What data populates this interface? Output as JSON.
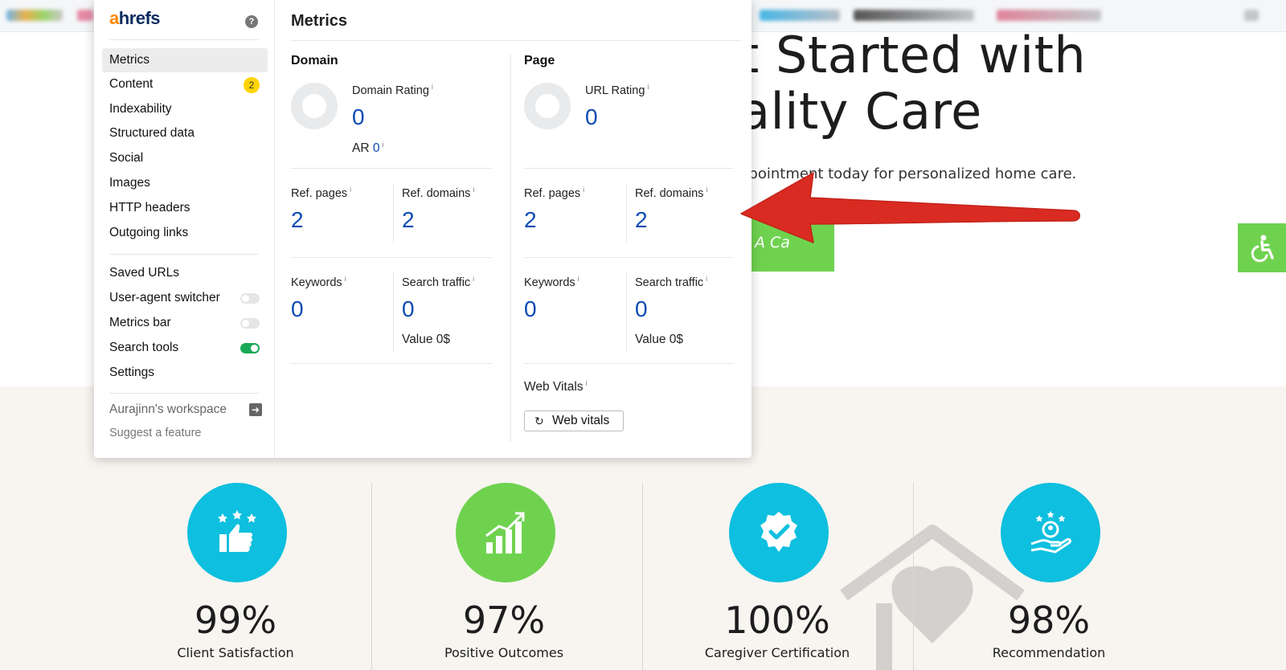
{
  "site": {
    "hero_line1": "t Started with",
    "hero_line2": "ality Care",
    "hero_subtitle": "ppointment today for personalized home care.",
    "cta_label": "le A Ca",
    "accessibility_icon": "wheelchair-icon",
    "accent_green": "#6fd24f",
    "accent_teal": "#0ebfdf",
    "stats": [
      {
        "value": "99%",
        "label": "Client Satisfaction",
        "icon": "thumbs-up-stars-icon",
        "color": "#0ebfdf"
      },
      {
        "value": "97%",
        "label": "Positive Outcomes",
        "icon": "growth-chart-icon",
        "color": "#6fd24f"
      },
      {
        "value": "100%",
        "label": "Caregiver Certification",
        "icon": "certified-badge-icon",
        "color": "#0ebfdf"
      },
      {
        "value": "98%",
        "label": "Recommendation",
        "icon": "care-hand-icon",
        "color": "#0ebfdf"
      }
    ]
  },
  "ahrefs": {
    "logo_first": "a",
    "logo_rest": "hrefs",
    "nav": [
      {
        "label": "Metrics",
        "active": true
      },
      {
        "label": "Content",
        "badge": "2"
      },
      {
        "label": "Indexability"
      },
      {
        "label": "Structured data"
      },
      {
        "label": "Social"
      },
      {
        "label": "Images"
      },
      {
        "label": "HTTP headers"
      },
      {
        "label": "Outgoing links"
      }
    ],
    "tools": [
      {
        "label": "Saved URLs"
      },
      {
        "label": "User-agent switcher",
        "toggle": "off"
      },
      {
        "label": "Metrics bar",
        "toggle": "off"
      },
      {
        "label": "Search tools",
        "toggle": "on"
      },
      {
        "label": "Settings"
      }
    ],
    "workspace": "Aurajinn's workspace",
    "suggest": "Suggest a feature",
    "title": "Metrics",
    "domain": {
      "heading": "Domain",
      "rating_label": "Domain Rating",
      "rating_value": "0",
      "ar_label": "AR",
      "ar_value": "0",
      "ref_pages_label": "Ref. pages",
      "ref_pages_value": "2",
      "ref_domains_label": "Ref. domains",
      "ref_domains_value": "2",
      "keywords_label": "Keywords",
      "keywords_value": "0",
      "traffic_label": "Search traffic",
      "traffic_value": "0",
      "traffic_worth": "Value 0$"
    },
    "page": {
      "heading": "Page",
      "rating_label": "URL Rating",
      "rating_value": "0",
      "ref_pages_label": "Ref. pages",
      "ref_pages_value": "2",
      "ref_domains_label": "Ref. domains",
      "ref_domains_value": "2",
      "keywords_label": "Keywords",
      "keywords_value": "0",
      "traffic_label": "Search traffic",
      "traffic_value": "0",
      "traffic_worth": "Value 0$",
      "vitals_label": "Web Vitals",
      "vitals_button": "Web vitals"
    },
    "accent_orange": "#ff8800",
    "value_blue": "#0c4bb3",
    "toggle_on_green": "#18a957",
    "badge_yellow": "#ffd400"
  },
  "annotation": {
    "arrow_color": "#d92b21"
  }
}
